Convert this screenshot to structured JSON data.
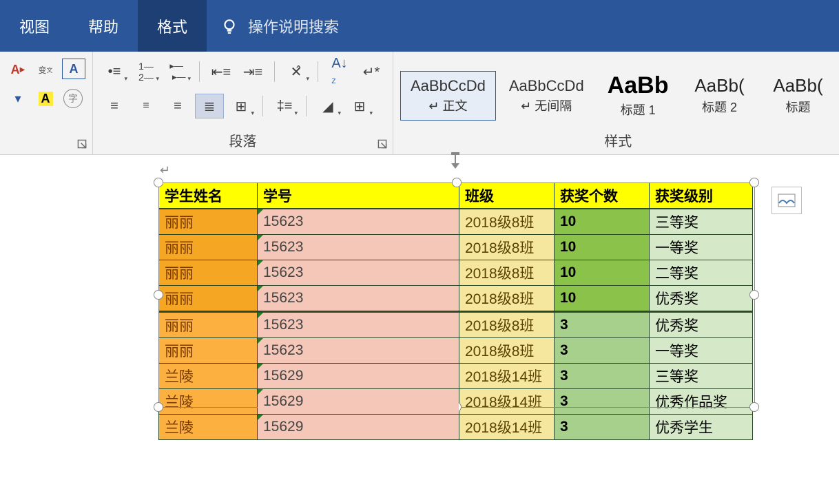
{
  "titlebar": {
    "tabs": [
      "视图",
      "帮助",
      "格式"
    ],
    "active_tab": 2,
    "search_placeholder": "操作说明搜索"
  },
  "ribbon": {
    "font_group_label": "",
    "paragraph_group_label": "段落",
    "styles_group_label": "样式",
    "styles": [
      {
        "preview": "AaBbCcDd",
        "caption": "↵ 正文",
        "kind": "normal",
        "active": true
      },
      {
        "preview": "AaBbCcDd",
        "caption": "↵ 无间隔",
        "kind": "normal",
        "active": false
      },
      {
        "preview": "AaBb",
        "caption": "标题 1",
        "kind": "big",
        "active": false
      },
      {
        "preview": "AaBb(",
        "caption": "标题 2",
        "kind": "mid",
        "active": false
      },
      {
        "preview": "AaBb(",
        "caption": "标题",
        "kind": "mid",
        "active": false
      }
    ]
  },
  "table": {
    "headers": [
      "学生姓名",
      "学号",
      "班级",
      "获奖个数",
      "获奖级别"
    ],
    "rows": [
      {
        "name": "丽丽",
        "id": "15623",
        "class": "2018级8班",
        "count": "10",
        "level": "三等奖",
        "shade": 1,
        "divider": false
      },
      {
        "name": "丽丽",
        "id": "15623",
        "class": "2018级8班",
        "count": "10",
        "level": "一等奖",
        "shade": 1,
        "divider": false
      },
      {
        "name": "丽丽",
        "id": "15623",
        "class": "2018级8班",
        "count": "10",
        "level": "二等奖",
        "shade": 1,
        "divider": false
      },
      {
        "name": "丽丽",
        "id": "15623",
        "class": "2018级8班",
        "count": "10",
        "level": "优秀奖",
        "shade": 1,
        "divider": true
      },
      {
        "name": "丽丽",
        "id": "15623",
        "class": "2018级8班",
        "count": "3",
        "level": "优秀奖",
        "shade": 2,
        "divider": false
      },
      {
        "name": "丽丽",
        "id": "15623",
        "class": "2018级8班",
        "count": "3",
        "level": "一等奖",
        "shade": 2,
        "divider": false
      },
      {
        "name": "兰陵",
        "id": "15629",
        "class": "2018级14班",
        "count": "3",
        "level": "三等奖",
        "shade": 2,
        "divider": false
      },
      {
        "name": "兰陵",
        "id": "15629",
        "class": "2018级14班",
        "count": "3",
        "level": "优秀作品奖",
        "shade": 2,
        "divider": false
      },
      {
        "name": "兰陵",
        "id": "15629",
        "class": "2018级14班",
        "count": "3",
        "level": "优秀学生",
        "shade": 2,
        "divider": false
      }
    ]
  }
}
